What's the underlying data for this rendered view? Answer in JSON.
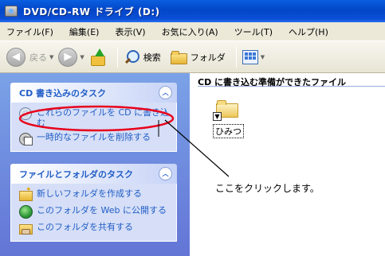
{
  "window": {
    "title": "DVD/CD-RW ドライブ (D:)"
  },
  "menu": [
    "ファイル(F)",
    "編集(E)",
    "表示(V)",
    "お気に入り(A)",
    "ツール(T)",
    "ヘルプ(H)"
  ],
  "toolbar": {
    "back_label": "戻る",
    "search_label": "検索",
    "folders_label": "フォルダ"
  },
  "left_panel": {
    "cd_tasks": {
      "title": "CD 書き込みのタスク",
      "items": [
        {
          "label": "これらのファイルを CD に書き込む",
          "icon": "cd-write-icon"
        },
        {
          "label": "一時的なファイルを削除する",
          "icon": "cd-delete-icon"
        }
      ]
    },
    "file_tasks": {
      "title": "ファイルとフォルダのタスク",
      "items": [
        {
          "label": "新しいフォルダを作成する",
          "icon": "new-folder-icon"
        },
        {
          "label": "このフォルダを Web に公開する",
          "icon": "globe-icon"
        },
        {
          "label": "このフォルダを共有する",
          "icon": "share-folder-icon"
        }
      ]
    }
  },
  "content": {
    "group_header": "CD に書き込む準備ができたファイル",
    "files": [
      {
        "name": "ひみつ",
        "icon": "folder-icon"
      }
    ]
  },
  "annotation": {
    "text": "ここをクリックします。",
    "color": "#e8001c"
  }
}
